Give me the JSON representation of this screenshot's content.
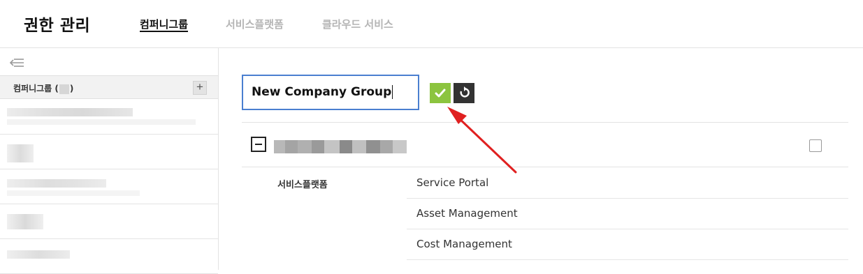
{
  "app": {
    "title": "권한 관리"
  },
  "tabs": [
    {
      "label": "컴퍼니그룹",
      "active": true
    },
    {
      "label": "서비스플랫폼",
      "active": false
    },
    {
      "label": "클라우드 서비스",
      "active": false
    }
  ],
  "sidebar": {
    "collapse_icon": "collapse-left-icon",
    "header_label_prefix": "컴퍼니그룹 (",
    "header_label_suffix": ")",
    "add_label": "+"
  },
  "editor": {
    "name_value": "New Company Group",
    "confirm_icon": "check-icon",
    "reset_icon": "refresh-icon"
  },
  "detail": {
    "row_label": "서비스플랫폼",
    "services": [
      "Service Portal",
      "Asset Management",
      "Cost Management"
    ]
  },
  "colors": {
    "accent_input_border": "#4a7fd0",
    "confirm_green": "#8cc43f",
    "reset_dark": "#333333",
    "arrow_red": "#e02020"
  }
}
